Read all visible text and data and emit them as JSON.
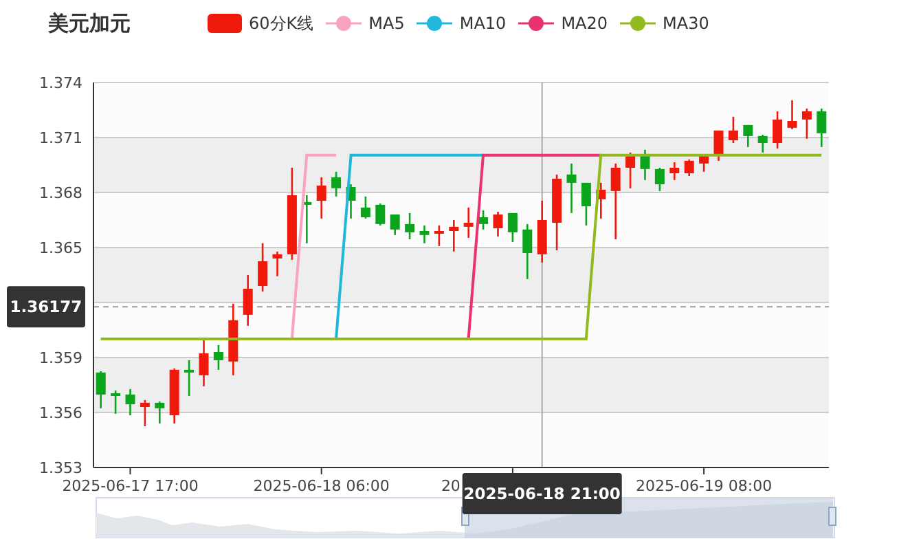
{
  "title": "美元加元",
  "covered_x_axis_label": "20",
  "crosshair_x_label": "2025-06-18 21:00",
  "chart_data": {
    "type": "candlestick",
    "grid": true,
    "ylim": [
      1.353,
      1.374
    ],
    "yticks": [
      1.374,
      1.371,
      1.368,
      1.365,
      1.359,
      1.356,
      1.353
    ],
    "categories": [
      null,
      null,
      "2025-06-17 17:00",
      null,
      null,
      null,
      null,
      null,
      null,
      null,
      null,
      null,
      null,
      null,
      null,
      "2025-06-18 06:00",
      null,
      null,
      null,
      null,
      null,
      null,
      null,
      null,
      null,
      null,
      null,
      null,
      null,
      null,
      null,
      null,
      null,
      null,
      null,
      null,
      null,
      null,
      null,
      null,
      null,
      "2025-06-19 08:00",
      null,
      null,
      null,
      null,
      null,
      null,
      null,
      null
    ],
    "series": [
      {
        "name": "60分K线",
        "color": "#f01a0c",
        "colors": [
          "#0aa51c",
          "#0aa51c",
          "#0aa51c",
          "#f01a0c",
          "#0aa51c",
          "#f01a0c",
          "#0aa51c",
          "#f01a0c",
          "#0aa51c",
          "#f01a0c",
          "#f01a0c",
          "#f01a0c",
          "#f01a0c",
          "#f01a0c",
          "#0aa51c",
          "#f01a0c",
          "#0aa51c",
          "#0aa51c",
          "#0aa51c",
          "#0aa51c",
          "#0aa51c",
          "#0aa51c",
          "#0aa51c",
          "#f01a0c",
          "#f01a0c",
          "#f01a0c",
          "#0aa51c",
          "#f01a0c",
          "#0aa51c",
          "#0aa51c",
          "#f01a0c",
          "#f01a0c",
          "#0aa51c",
          "#0aa51c",
          "#f01a0c",
          "#f01a0c",
          "#f01a0c",
          "#0aa51c",
          "#0aa51c",
          "#f01a0c",
          "#f01a0c",
          "#f01a0c",
          "#f01a0c",
          "#f01a0c",
          "#0aa51c",
          "#0aa51c",
          "#f01a0c",
          "#f01a0c",
          "#f01a0c",
          "#0aa51c"
        ],
        "ohlc": [
          [
            1.35818,
            1.35825,
            1.35623,
            1.35698
          ],
          [
            1.35705,
            1.3572,
            1.35593,
            1.3569
          ],
          [
            1.35698,
            1.35728,
            1.35585,
            1.35645
          ],
          [
            1.3563,
            1.35668,
            1.35525,
            1.35653
          ],
          [
            1.35653,
            1.3566,
            1.3554,
            1.35623
          ],
          [
            1.35585,
            1.3584,
            1.3554,
            1.35833
          ],
          [
            1.35833,
            1.35885,
            1.3569,
            1.35818
          ],
          [
            1.35803,
            1.35998,
            1.35743,
            1.35923
          ],
          [
            1.3593,
            1.35968,
            1.35833,
            1.35885
          ],
          [
            1.35878,
            1.36193,
            1.35803,
            1.36103
          ],
          [
            1.36133,
            1.3635,
            1.36073,
            1.36275
          ],
          [
            1.3629,
            1.36523,
            1.3626,
            1.36425
          ],
          [
            1.3644,
            1.36478,
            1.36343,
            1.36463
          ],
          [
            1.36463,
            1.36935,
            1.36433,
            1.36785
          ],
          [
            1.36748,
            1.36785,
            1.36523,
            1.36733
          ],
          [
            1.36755,
            1.36883,
            1.36658,
            1.36838
          ],
          [
            1.36883,
            1.36913,
            1.36778,
            1.36823
          ],
          [
            1.3683,
            1.36845,
            1.36658,
            1.36755
          ],
          [
            1.36718,
            1.36778,
            1.36658,
            1.36665
          ],
          [
            1.36733,
            1.3674,
            1.3662,
            1.36628
          ],
          [
            1.3668,
            1.3668,
            1.36568,
            1.36598
          ],
          [
            1.36628,
            1.36688,
            1.36545,
            1.36583
          ],
          [
            1.3659,
            1.3662,
            1.36523,
            1.36568
          ],
          [
            1.36575,
            1.3662,
            1.36508,
            1.3659
          ],
          [
            1.3659,
            1.3665,
            1.36478,
            1.36613
          ],
          [
            1.36613,
            1.36718,
            1.36553,
            1.36635
          ],
          [
            1.36665,
            1.36703,
            1.36598,
            1.36628
          ],
          [
            1.36605,
            1.36695,
            1.3656,
            1.3668
          ],
          [
            1.36688,
            1.36688,
            1.3653,
            1.36583
          ],
          [
            1.36598,
            1.36628,
            1.36328,
            1.3647
          ],
          [
            1.36463,
            1.36755,
            1.36418,
            1.3665
          ],
          [
            1.36635,
            1.36898,
            1.36485,
            1.36875
          ],
          [
            1.36898,
            1.36958,
            1.36688,
            1.36853
          ],
          [
            1.36853,
            1.36853,
            1.3662,
            1.36725
          ],
          [
            1.36763,
            1.36853,
            1.36658,
            1.36815
          ],
          [
            1.36808,
            1.36958,
            1.36545,
            1.36935
          ],
          [
            1.36935,
            1.37018,
            1.36823,
            1.3701
          ],
          [
            1.3701,
            1.37033,
            1.36868,
            1.36928
          ],
          [
            1.36928,
            1.36935,
            1.36808,
            1.36845
          ],
          [
            1.36905,
            1.36965,
            1.36868,
            1.36935
          ],
          [
            1.36905,
            1.3698,
            1.3689,
            1.36973
          ],
          [
            1.36958,
            1.3701,
            1.36913,
            1.3701
          ],
          [
            1.37003,
            1.37138,
            1.36973,
            1.37138
          ],
          [
            1.37085,
            1.37213,
            1.3707,
            1.37138
          ],
          [
            1.37168,
            1.37168,
            1.37048,
            1.37108
          ],
          [
            1.37108,
            1.37115,
            1.37018,
            1.3707
          ],
          [
            1.3707,
            1.37243,
            1.3704,
            1.37198
          ],
          [
            1.37153,
            1.37303,
            1.37145,
            1.3719
          ],
          [
            1.37198,
            1.37258,
            1.37093,
            1.37243
          ],
          [
            1.37243,
            1.37258,
            1.37048,
            1.37123
          ]
        ]
      },
      {
        "name": "MA5",
        "type": "line",
        "color": "#f9a3c0",
        "values": [
          null,
          null,
          null,
          null,
          null,
          null,
          null,
          null,
          null,
          null,
          null,
          null,
          null,
          1.36001,
          1.37003,
          1.37003,
          1.37003,
          null,
          null,
          null,
          null,
          null,
          null,
          null,
          null,
          null,
          null,
          null,
          null,
          null,
          null,
          null,
          null,
          null,
          null,
          null,
          null,
          null,
          null,
          null,
          null,
          null,
          null,
          null,
          null,
          null,
          null,
          null,
          null,
          null
        ]
      },
      {
        "name": "MA10",
        "type": "line",
        "color": "#1fb8d8",
        "values": [
          null,
          null,
          null,
          null,
          null,
          null,
          null,
          null,
          null,
          null,
          null,
          null,
          null,
          null,
          null,
          null,
          1.36001,
          1.37003,
          1.37003,
          1.37003,
          1.37003,
          1.37003,
          1.37003,
          1.37003,
          1.37003,
          1.37003,
          1.37003,
          null,
          null,
          null,
          null,
          null,
          null,
          null,
          null,
          null,
          null,
          null,
          null,
          null,
          null,
          null,
          null,
          null,
          null,
          null,
          null,
          null,
          null,
          null
        ]
      },
      {
        "name": "MA20",
        "type": "line",
        "color": "#e8336f",
        "values": [
          null,
          null,
          null,
          null,
          null,
          null,
          null,
          null,
          null,
          null,
          null,
          null,
          null,
          null,
          null,
          null,
          null,
          null,
          null,
          null,
          null,
          null,
          null,
          null,
          null,
          1.36001,
          1.37003,
          1.37003,
          1.37003,
          1.37003,
          1.37003,
          1.37003,
          1.37003,
          1.37003,
          1.37003,
          null,
          null,
          null,
          null,
          null,
          null,
          null,
          null,
          null,
          null,
          null,
          null,
          null,
          null,
          null
        ]
      },
      {
        "name": "MA30",
        "type": "line",
        "color": "#93b91e",
        "values": [
          1.36001,
          1.36001,
          1.36001,
          1.36001,
          1.36001,
          1.36001,
          1.36001,
          1.36001,
          1.36001,
          1.36001,
          1.36001,
          1.36001,
          1.36001,
          1.36001,
          1.36001,
          1.36001,
          1.36001,
          1.36001,
          1.36001,
          1.36001,
          1.36001,
          1.36001,
          1.36001,
          1.36001,
          1.36001,
          1.36001,
          1.36001,
          1.36001,
          1.36001,
          1.36001,
          1.36001,
          1.36001,
          1.36001,
          1.36001,
          1.37003,
          1.37003,
          1.37003,
          1.37003,
          1.37003,
          1.37003,
          1.37003,
          1.37003,
          1.37003,
          1.37003,
          1.37003,
          1.37003,
          1.37003,
          1.37003,
          1.37003,
          1.37003
        ]
      }
    ],
    "bands": [
      {
        "axis": "y",
        "from": 1.368,
        "to": 1.371
      },
      {
        "axis": "y",
        "from": 1.362,
        "to": 1.365
      },
      {
        "axis": "y",
        "from": 1.356,
        "to": 1.359
      }
    ],
    "ref_lines": [
      {
        "axis": "y",
        "value": 1.36177,
        "label": "1.36177"
      }
    ]
  }
}
